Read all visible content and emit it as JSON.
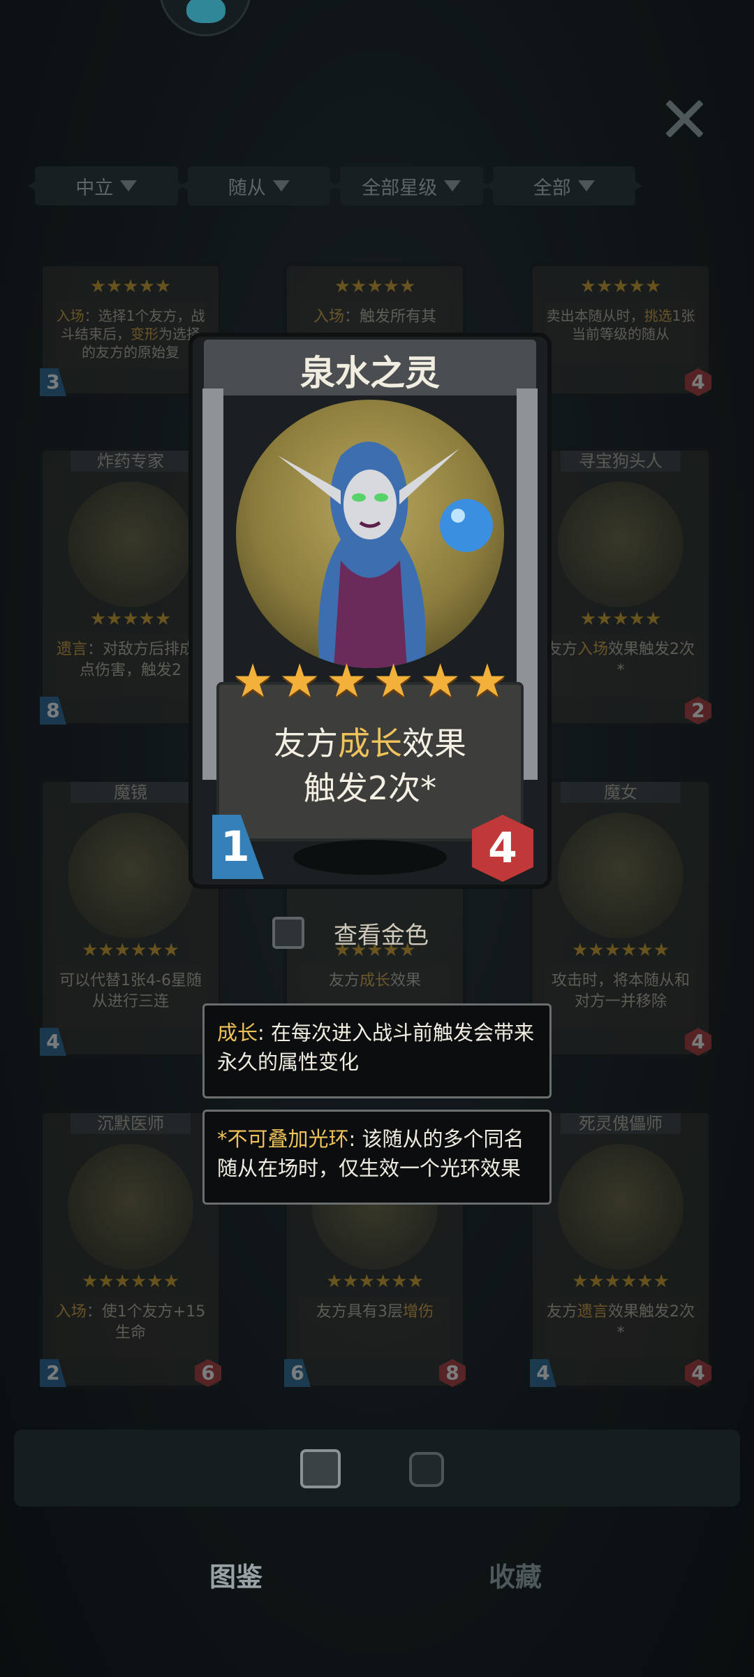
{
  "filters": [
    {
      "label": "中立"
    },
    {
      "label": "随从"
    },
    {
      "label": "全部星级"
    },
    {
      "label": "全部"
    }
  ],
  "background_cards": [
    {
      "name": "",
      "desc_parts": [
        "入场",
        "：选择1个友方，战斗结束后，",
        "变形",
        "为选择的友方的原始复"
      ],
      "cost": "3",
      "hp": ""
    },
    {
      "name": "",
      "desc_parts": [
        "入场",
        "：触发所有其"
      ],
      "cost": "",
      "hp": ""
    },
    {
      "name": "",
      "desc_parts": [
        "卖出本随从时，",
        "挑选",
        "1张当前等级的随从"
      ],
      "cost": "",
      "hp": "4"
    },
    {
      "name": "炸药专家",
      "desc_parts": [
        "遗言",
        "：对敌方后排",
        "成4点伤害，触发2"
      ],
      "cost": "8",
      "hp": ""
    },
    {
      "name": "寻宝狗头人",
      "desc_parts": [
        "友方",
        "入场",
        "效果触发2次*"
      ],
      "cost": "",
      "hp": "2"
    },
    {
      "name": "魔镜",
      "desc_parts": [
        "可以代替1张4-6星随从进行三连"
      ],
      "cost": "4",
      "hp": ""
    },
    {
      "name": "",
      "desc_parts": [
        "友方",
        "成长",
        "效果"
      ],
      "cost": "",
      "hp": ""
    },
    {
      "name": "魔女",
      "desc_parts": [
        "攻击时，将本随从和对方一并移除"
      ],
      "cost": "",
      "hp": "4"
    },
    {
      "name": "沉默医师",
      "desc_parts": [
        "入场",
        "：使1个友方+15生命"
      ],
      "cost": "2",
      "hp": "6"
    },
    {
      "name": "",
      "desc_parts": [
        "友方具有3层",
        "增伤"
      ],
      "cost": "6",
      "hp": "8"
    },
    {
      "name": "死灵傀儡师",
      "desc_parts": [
        "友方",
        "遗言",
        "效果触发2次*"
      ],
      "cost": "4",
      "hp": "4"
    }
  ],
  "featured_card": {
    "name": "泉水之灵",
    "stars": 6,
    "effect_prefix": "友方",
    "effect_keyword": "成长",
    "effect_suffix": "效果",
    "effect_line2": "触发2次*",
    "cost": "1",
    "hp": "4",
    "accent_color": "#f0c35a"
  },
  "golden_toggle": {
    "label": "查看金色",
    "checked": false
  },
  "tooltips": [
    {
      "keyword": "成长",
      "text": ": 在每次进入战斗前触发会带来永久的属性变化"
    },
    {
      "keyword": "*不可叠加光环",
      "text": ": 该随从的多个同名随从在场时，仅生效一个光环效果"
    }
  ],
  "bottom_tabs": [
    {
      "label": "图鉴",
      "active": true
    },
    {
      "label": "收藏",
      "active": false
    }
  ],
  "icons": {
    "close": "close-icon",
    "filter_arrow": "triangle-down-icon",
    "cards": "cards-icon",
    "collection": "avatar-frame-icon"
  }
}
